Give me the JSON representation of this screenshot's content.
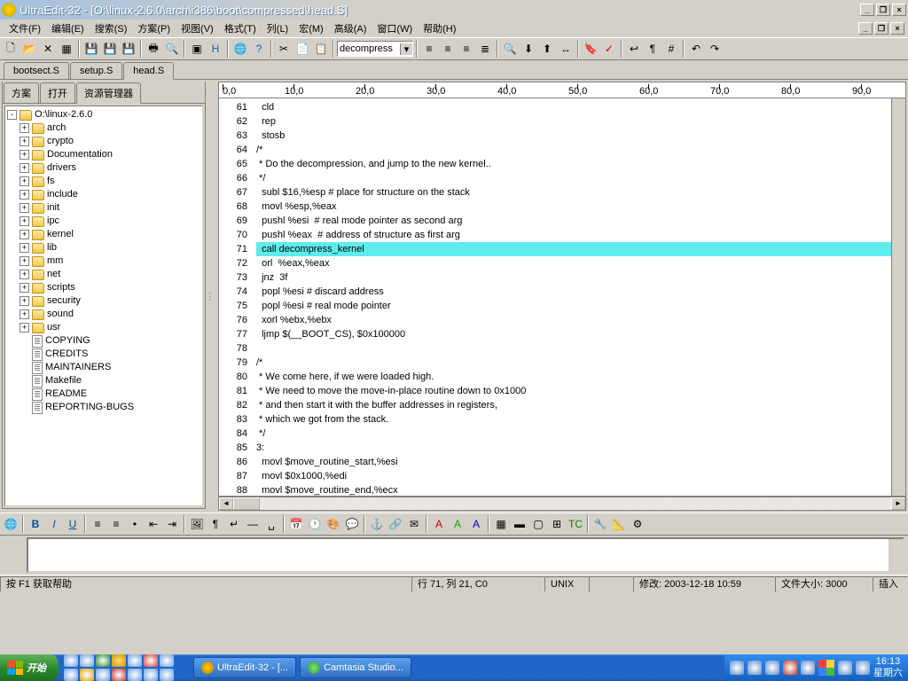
{
  "window": {
    "title": "UltraEdit-32 - [O:\\linux-2.6.0\\arch\\i386\\boot\\compressed\\head.S]"
  },
  "menu": [
    "文件(F)",
    "编辑(E)",
    "搜索(S)",
    "方案(P)",
    "视图(V)",
    "格式(T)",
    "列(L)",
    "宏(M)",
    "高级(A)",
    "窗口(W)",
    "帮助(H)"
  ],
  "find_value": "decompress",
  "file_tabs": [
    {
      "label": "bootsect.S",
      "active": false
    },
    {
      "label": "setup.S",
      "active": false
    },
    {
      "label": "head.S",
      "active": true
    }
  ],
  "side_tabs": [
    {
      "label": "方案"
    },
    {
      "label": "打开"
    },
    {
      "label": "资源管理器",
      "active": true
    }
  ],
  "tree": {
    "root": "O:\\linux-2.6.0",
    "folders": [
      "arch",
      "crypto",
      "Documentation",
      "drivers",
      "fs",
      "include",
      "init",
      "ipc",
      "kernel",
      "lib",
      "mm",
      "net",
      "scripts",
      "security",
      "sound",
      "usr"
    ],
    "files": [
      "COPYING",
      "CREDITS",
      "MAINTAINERS",
      "Makefile",
      "README",
      "REPORTING-BUGS"
    ]
  },
  "ruler_marks": [
    0,
    10,
    20,
    30,
    40,
    50,
    60,
    70,
    80,
    90
  ],
  "code_lines": [
    {
      "n": 61,
      "t": "  cld"
    },
    {
      "n": 62,
      "t": "  rep"
    },
    {
      "n": 63,
      "t": "  stosb"
    },
    {
      "n": 64,
      "t": "/*"
    },
    {
      "n": 65,
      "t": " * Do the decompression, and jump to the new kernel.."
    },
    {
      "n": 66,
      "t": " */"
    },
    {
      "n": 67,
      "t": "  subl $16,%esp # place for structure on the stack"
    },
    {
      "n": 68,
      "t": "  movl %esp,%eax"
    },
    {
      "n": 69,
      "t": "  pushl %esi  # real mode pointer as second arg"
    },
    {
      "n": 70,
      "t": "  pushl %eax  # address of structure as first arg"
    },
    {
      "n": 71,
      "t": "  call decompress_kernel",
      "hl": true
    },
    {
      "n": 72,
      "t": "  orl  %eax,%eax"
    },
    {
      "n": 73,
      "t": "  jnz  3f"
    },
    {
      "n": 74,
      "t": "  popl %esi # discard address"
    },
    {
      "n": 75,
      "t": "  popl %esi # real mode pointer"
    },
    {
      "n": 76,
      "t": "  xorl %ebx,%ebx"
    },
    {
      "n": 77,
      "t": "  ljmp $(__BOOT_CS), $0x100000"
    },
    {
      "n": 78,
      "t": ""
    },
    {
      "n": 79,
      "t": "/*"
    },
    {
      "n": 80,
      "t": " * We come here, if we were loaded high."
    },
    {
      "n": 81,
      "t": " * We need to move the move-in-place routine down to 0x1000"
    },
    {
      "n": 82,
      "t": " * and then start it with the buffer addresses in registers,"
    },
    {
      "n": 83,
      "t": " * which we got from the stack."
    },
    {
      "n": 84,
      "t": " */"
    },
    {
      "n": 85,
      "t": "3:"
    },
    {
      "n": 86,
      "t": "  movl $move_routine_start,%esi"
    },
    {
      "n": 87,
      "t": "  movl $0x1000,%edi"
    },
    {
      "n": 88,
      "t": "  movl $move_routine_end,%ecx"
    }
  ],
  "status": {
    "help": "按 F1 获取帮助",
    "pos": "行 71, 列 21, C0",
    "encoding": "UNIX",
    "modified": "修改:  2003-12-18 10:59",
    "filesize": "文件大小: 3000",
    "mode": "插入"
  },
  "taskbar": {
    "start": "开始",
    "tasks": [
      {
        "label": "UltraEdit-32 - [...",
        "cls": ""
      },
      {
        "label": "Camtasia Studio...",
        "cls": "green"
      }
    ],
    "time": "16:13",
    "day": "星期六"
  }
}
